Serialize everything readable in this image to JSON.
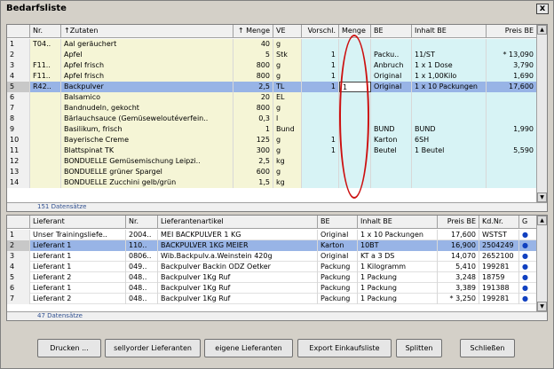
{
  "window": {
    "title": "Bedarfsliste",
    "close": "x"
  },
  "top": {
    "headers": [
      "",
      "Nr.",
      "↑Zutaten",
      "↑ Menge",
      "VE",
      "Vorschl.",
      "Menge",
      "BE",
      "Inhalt BE",
      "Preis BE",
      ""
    ],
    "rows": [
      {
        "n": "1",
        "nr": "T04..",
        "name": "Aal geräuchert",
        "menge": "40",
        "ve": "g",
        "vor": "",
        "m": "",
        "be": "",
        "inh": "",
        "preis": ""
      },
      {
        "n": "2",
        "nr": "",
        "name": "Apfel",
        "menge": "5",
        "ve": "Stk",
        "vor": "1",
        "m": "",
        "be": "Packu..",
        "inh": "11/ST",
        "preis": "* 13,090"
      },
      {
        "n": "3",
        "nr": "F11..",
        "name": "Apfel frisch",
        "menge": "800",
        "ve": "g",
        "vor": "1",
        "m": "",
        "be": "Anbruch",
        "inh": "1 x 1 Dose",
        "preis": "3,790"
      },
      {
        "n": "4",
        "nr": "F11..",
        "name": "Apfel frisch",
        "menge": "800",
        "ve": "g",
        "vor": "1",
        "m": "",
        "be": "Original",
        "inh": "1 x 1,00Kilo",
        "preis": "1,690"
      },
      {
        "n": "5",
        "nr": "R42..",
        "name": "Backpulver",
        "menge": "2,5",
        "ve": "TL",
        "vor": "1",
        "m": "1",
        "be": "Original",
        "inh": "1 x 10 Packungen",
        "preis": "17,600"
      },
      {
        "n": "6",
        "nr": "",
        "name": "Balsamico",
        "menge": "20",
        "ve": "EL",
        "vor": "",
        "m": "",
        "be": "",
        "inh": "",
        "preis": ""
      },
      {
        "n": "7",
        "nr": "",
        "name": "Bandnudeln, gekocht",
        "menge": "800",
        "ve": "g",
        "vor": "",
        "m": "",
        "be": "",
        "inh": "",
        "preis": ""
      },
      {
        "n": "8",
        "nr": "",
        "name": "Bärlauchsauce (Gemüseweloutéverfein..",
        "menge": "0,3",
        "ve": "l",
        "vor": "",
        "m": "",
        "be": "",
        "inh": "",
        "preis": ""
      },
      {
        "n": "9",
        "nr": "",
        "name": "Basilikum, frisch",
        "menge": "1",
        "ve": "Bund",
        "vor": "",
        "m": "",
        "be": "BUND",
        "inh": "BUND",
        "preis": "1,990"
      },
      {
        "n": "10",
        "nr": "",
        "name": "Bayerische Creme",
        "menge": "125",
        "ve": "g",
        "vor": "1",
        "m": "",
        "be": "Karton",
        "inh": "6SH",
        "preis": ""
      },
      {
        "n": "11",
        "nr": "",
        "name": "Blattspinat TK",
        "menge": "300",
        "ve": "g",
        "vor": "1",
        "m": "",
        "be": "Beutel",
        "inh": "1 Beutel",
        "preis": "5,590"
      },
      {
        "n": "12",
        "nr": "",
        "name": "BONDUELLE Gemüsemischung Leipzi..",
        "menge": "2,5",
        "ve": "kg",
        "vor": "",
        "m": "",
        "be": "",
        "inh": "",
        "preis": ""
      },
      {
        "n": "13",
        "nr": "",
        "name": "BONDUELLE grüner Spargel",
        "menge": "600",
        "ve": "g",
        "vor": "",
        "m": "",
        "be": "",
        "inh": "",
        "preis": ""
      },
      {
        "n": "14",
        "nr": "",
        "name": "BONDUELLE Zucchini gelb/grün",
        "menge": "1,5",
        "ve": "kg",
        "vor": "",
        "m": "",
        "be": "",
        "inh": "",
        "preis": ""
      }
    ],
    "footer": "151 Datensätze"
  },
  "bottom": {
    "headers": [
      "",
      "Lieferant",
      "Nr.",
      "Lieferantenartikel",
      "BE",
      "Inhalt BE",
      "Preis BE",
      "Kd.Nr.",
      "G"
    ],
    "rows": [
      {
        "n": "1",
        "lief": "Unser Trainingsliefe..",
        "nr": "2004..",
        "art": "MEI BACKPULVER 1 KG",
        "be": "Original",
        "inh": "1 x 10 Packungen",
        "preis": "17,600",
        "kd": "WSTST",
        "g": "●"
      },
      {
        "n": "2",
        "lief": "Lieferant 1",
        "nr": "110..",
        "art": "BACKPULVER 1KG MEIER",
        "be": "Karton",
        "inh": "10BT",
        "preis": "16,900",
        "kd": "2504249",
        "g": "●"
      },
      {
        "n": "3",
        "lief": "Lieferant 1",
        "nr": "0806..",
        "art": "Wib.Backpulv.a.Weinstein 420g",
        "be": "Original",
        "inh": "KT a 3 DS",
        "preis": "14,070",
        "kd": "2652100",
        "g": "●"
      },
      {
        "n": "4",
        "lief": "Lieferant 1",
        "nr": "049..",
        "art": "Backpulver Backin ODZ Oetker",
        "be": "Packung",
        "inh": "1 Kilogramm",
        "preis": "5,410",
        "kd": "199281",
        "g": "●"
      },
      {
        "n": "5",
        "lief": "Lieferant 2",
        "nr": "048..",
        "art": "Backpulver 1Kg Ruf",
        "be": "Packung",
        "inh": "1 Packung",
        "preis": "3,248",
        "kd": "18759",
        "g": "●"
      },
      {
        "n": "6",
        "lief": "Lieferant 1",
        "nr": "048..",
        "art": "Backpulver 1Kg Ruf",
        "be": "Packung",
        "inh": "1 Packung",
        "preis": "3,389",
        "kd": "191388",
        "g": "●"
      },
      {
        "n": "7",
        "lief": "Lieferant 2",
        "nr": "048..",
        "art": "Backpulver 1Kg Ruf",
        "be": "Packung",
        "inh": "1 Packung",
        "preis": "* 3,250",
        "kd": "199281",
        "g": "●"
      }
    ],
    "footer": "47 Datensätze"
  },
  "buttons": [
    "Drucken ...",
    "sellyorder Lieferanten",
    "eigene Lieferanten",
    "Export Einkaufsliste",
    "Splitten",
    "Schließen"
  ],
  "colors": {
    "selected": "#98b4e6",
    "yellow": "#f5f5d6",
    "cyan": "#d7f3f5",
    "annotation": "#cc1010"
  }
}
